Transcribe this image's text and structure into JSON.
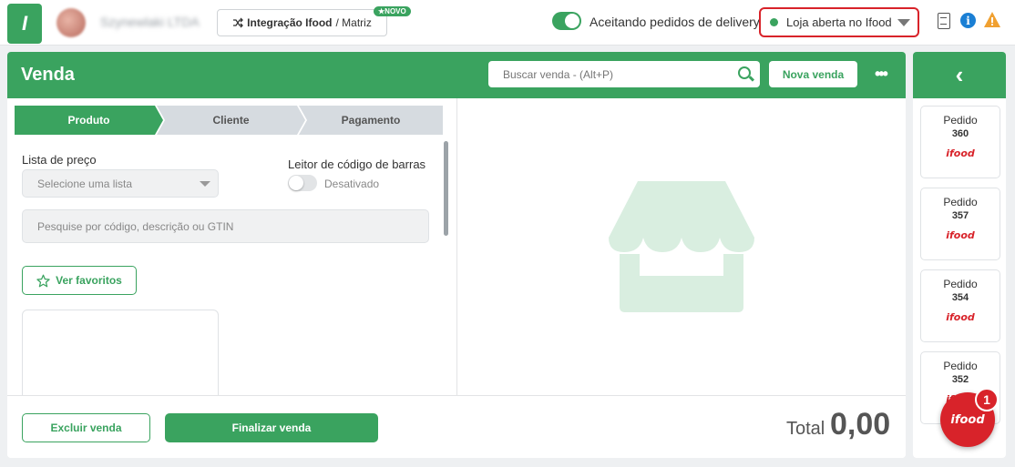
{
  "header": {
    "logo_text": "I",
    "company_name": "Szynewlaki LTDA",
    "integration_button": {
      "label_bold": "Integração Ifood",
      "label_rest": "/ Matriz",
      "badge": "★NOVO"
    },
    "delivery_toggle_label": "Aceitando pedidos de delivery",
    "delivery_toggle_on": true,
    "store_status": "Loja aberta no Ifood"
  },
  "sale": {
    "title": "Venda",
    "search_placeholder": "Buscar venda - (Alt+P)",
    "new_sale_label": "Nova venda",
    "more_label": "•••",
    "steps": [
      "Produto",
      "Cliente",
      "Pagamento"
    ],
    "price_list_label": "Lista de preço",
    "price_list_placeholder": "Selecione uma lista",
    "barcode_label": "Leitor de código de barras",
    "barcode_state": "Desativado",
    "product_search_placeholder": "Pesquise por código, descrição ou GTIN",
    "favorites_label": "Ver favoritos",
    "cancel_label": "Excluir venda",
    "finish_label": "Finalizar venda",
    "total_label": "Total",
    "total_value": "0,00"
  },
  "orders": {
    "back_icon": "‹",
    "items": [
      {
        "label": "Pedido",
        "number": "360",
        "source": "ifood"
      },
      {
        "label": "Pedido",
        "number": "357",
        "source": "ifood"
      },
      {
        "label": "Pedido",
        "number": "354",
        "source": "ifood"
      },
      {
        "label": "Pedido",
        "number": "352",
        "source": "ifood"
      }
    ],
    "fab_label": "ifood",
    "fab_badge": "1"
  },
  "colors": {
    "primary": "#3aa35f",
    "alert": "#d8232a",
    "info": "#1a7fd4",
    "warning": "#f0a030"
  }
}
